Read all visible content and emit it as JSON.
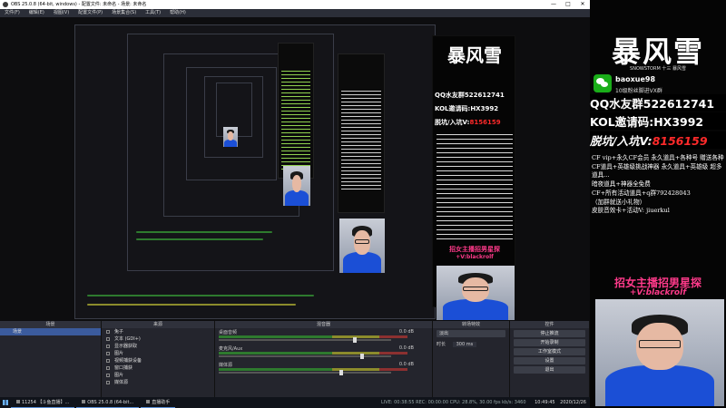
{
  "window": {
    "title": "OBS 25.0.8 (64-bit, windows) - 配置文件: 未命名 - 场景: 未命名",
    "min": "—",
    "max": "□",
    "close": "✕"
  },
  "menu": [
    "文件(F)",
    "编辑(E)",
    "视图(V)",
    "配置文件(P)",
    "场景集合(S)",
    "工具(T)",
    "帮助(H)"
  ],
  "overlay": {
    "logo": "暴风雪",
    "logo_sub": "SNOWSTORM 十三 暴风雪",
    "wechat_id": "baoxue98",
    "wechat_note": "10级粉丝脚进VX群",
    "qq_prefix": "QQ水友群",
    "qq_number": "522612741",
    "kol_prefix": "KOL邀请码:",
    "kol_code": "HX3992",
    "pit_prefix": "脱坑/入坑V:",
    "pit_number": "8156159",
    "notice": "CF vip+永久CF会员 永久道具+各种号 赠送各种CF道具+英雄级挑战神器 永久道具+英雄级 超多道具...\n暗夜道具+神器全免费\nCF+所有活动道具+q群792428043\n（加群就送小礼物）\n皮肤音效卡+活动V: jiuerkul",
    "pink_main": "招女主播招男星探",
    "pink_sub": "+V:blackrolf"
  },
  "docks": {
    "scenes": {
      "title": "场景",
      "items": [
        "场景"
      ]
    },
    "sources": {
      "title": "来源",
      "items": [
        "兔子",
        "文本 (GDI+)",
        "显示器获取",
        "图片",
        "视频捕获设备",
        "窗口捕获",
        "图片",
        "媒体源"
      ]
    },
    "mixer": {
      "title": "混音器",
      "rows": [
        {
          "name": "桌面音频",
          "db": "0.0 dB",
          "level": 0.78
        },
        {
          "name": "麦克风/Aux",
          "db": "0.0 dB",
          "level": 0.82
        },
        {
          "name": "媒体源",
          "db": "0.0 dB",
          "level": 0.7
        }
      ]
    },
    "transitions": {
      "title": "转场特效",
      "type": "淡出",
      "duration_label": "时长",
      "duration": "300 ms"
    },
    "controls": {
      "title": "控件",
      "buttons": [
        "停止推流",
        "开始录制",
        "工作室模式",
        "设置",
        "退出"
      ]
    }
  },
  "statusbar": {
    "text": "LIVE: 00:38:55   REC: 00:00:00   CPU: 28.8%, 30.00 fps   kb/s: 3460"
  },
  "taskbar": {
    "tasks": [
      "11254 【斗鱼直播】...",
      "OBS 25.0.8 (64-bit...",
      "直播助手"
    ],
    "time": "10:49:45",
    "date": "2020/12/26"
  },
  "colors": {
    "accent_red": "#ff2a2a",
    "pink": "#ff3a8a",
    "shirt_blue": "#1b4fd6"
  }
}
